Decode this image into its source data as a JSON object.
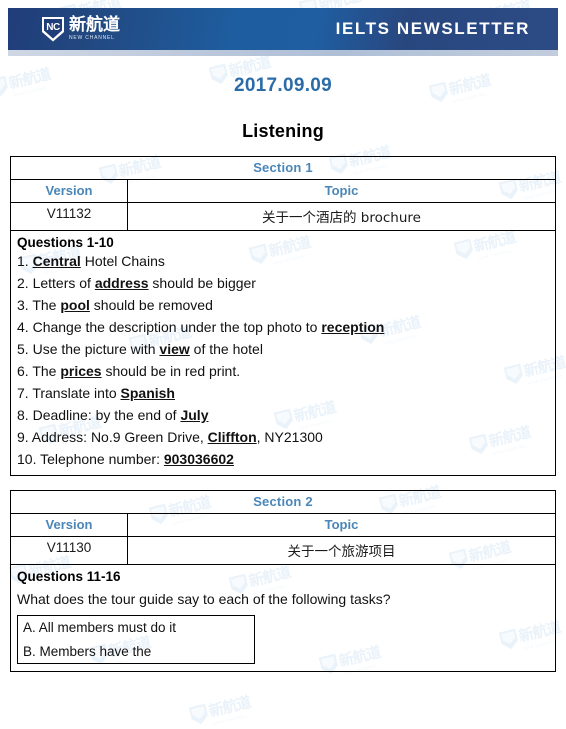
{
  "header": {
    "logo_cn": "新航道",
    "logo_en": "NEW CHANNEL",
    "logo_mark": "NC",
    "title": "IELTS  NEWSLETTER",
    "bar_color": "#1f5ea1"
  },
  "date": "2017.09.09",
  "doc_title": "Listening",
  "accent_color": "#4a86b8",
  "sections": [
    {
      "name": "Section 1",
      "columns": {
        "version": "Version",
        "topic": "Topic"
      },
      "version": "V11132",
      "topic": "关于一个酒店的 brochure",
      "questions_heading": "Questions 1-10",
      "questions": [
        {
          "num": "1.",
          "pre": " ",
          "key": "Central",
          "post": " Hotel Chains"
        },
        {
          "num": "2.",
          "pre": " Letters of ",
          "key": "address",
          "post": " should be bigger"
        },
        {
          "num": "3.",
          "pre": " The ",
          "key": "pool",
          "post": " should be removed"
        },
        {
          "num": "4.",
          "pre": " Change the description under the top photo to ",
          "key": "reception",
          "post": ""
        },
        {
          "num": "5.",
          "pre": " Use the picture with ",
          "key": "view",
          "post": " of the hotel"
        },
        {
          "num": "6.",
          "pre": " The ",
          "key": "prices",
          "post": " should be in red print."
        },
        {
          "num": "7.",
          "pre": " Translate into ",
          "key": "Spanish",
          "post": ""
        },
        {
          "num": "8.",
          "pre": " Deadline: by the end of ",
          "key": "July",
          "post": ""
        },
        {
          "num": "9.",
          "pre": " Address: No.9 Green Drive, ",
          "key": "Cliffton",
          "post": ", NY21300"
        },
        {
          "num": "10.",
          "pre": " Telephone number: ",
          "key": "903036602",
          "post": ""
        }
      ]
    },
    {
      "name": "Section 2",
      "columns": {
        "version": "Version",
        "topic": "Topic"
      },
      "version": "V11130",
      "topic": "关于一个旅游项目",
      "questions_heading": "Questions 11-16",
      "prompt": "What does the tour guide say to each of the following tasks?",
      "options": [
        "A. All members must do it",
        "B. Members have the"
      ]
    }
  ],
  "watermark": {
    "cn": "新航道",
    "en": "NEW CHANNEL"
  }
}
